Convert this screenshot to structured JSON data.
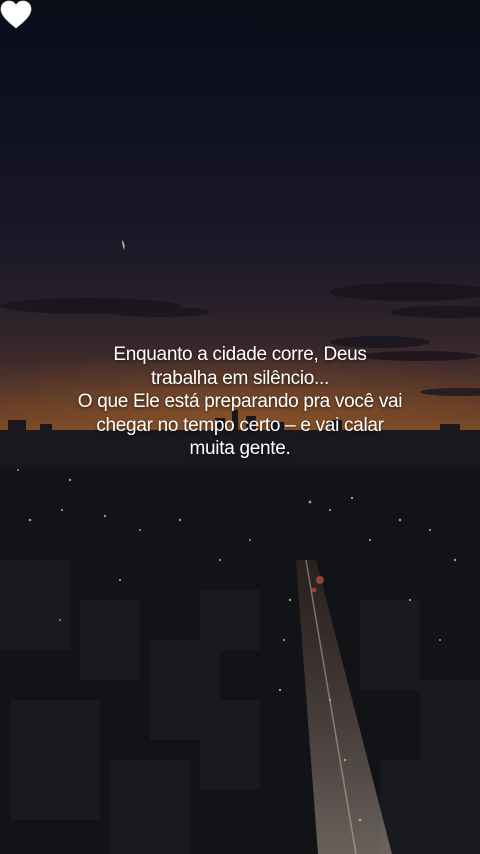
{
  "caption": {
    "lines": [
      "Enquanto a cidade corre, Deus",
      "trabalha em silêncio...",
      "O que Ele está preparando pra você vai",
      "chegar no tempo certo – e vai calar",
      "muita gente."
    ]
  },
  "emoji": {
    "name": "white-heart-icon"
  },
  "colors": {
    "text": "#ffffff",
    "sky_top": "#0c0f1c",
    "horizon": "#8a5a30",
    "city": "#14151a"
  }
}
